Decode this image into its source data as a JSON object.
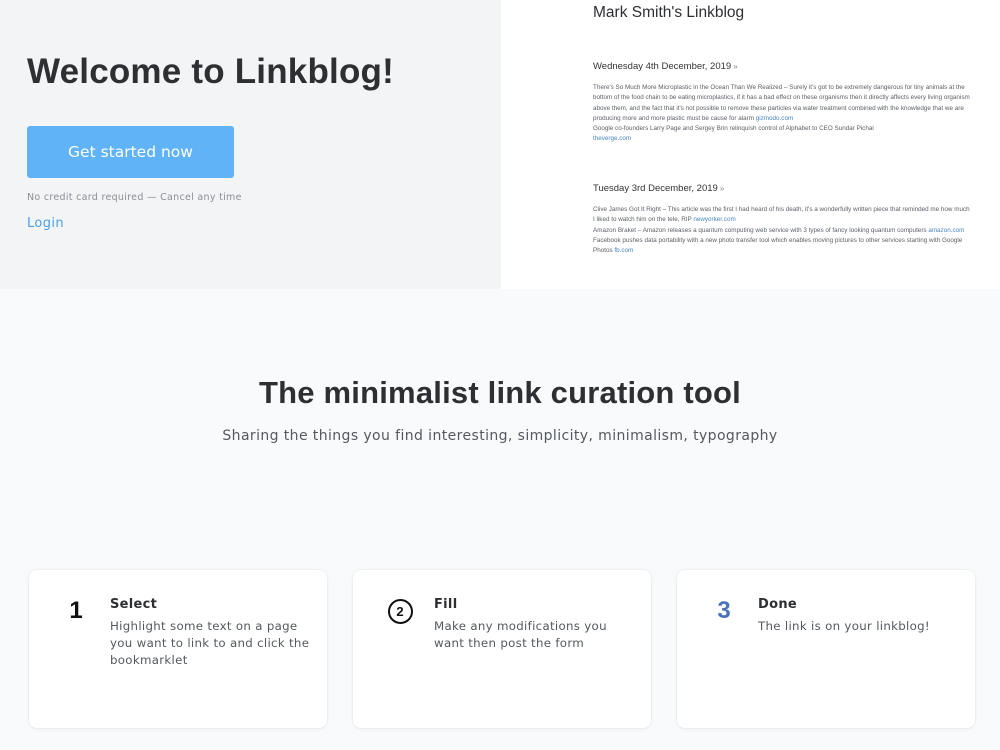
{
  "hero": {
    "title": "Welcome to Linkblog!",
    "cta_label": "Get started now",
    "fineprint": "No credit card required — Cancel any time",
    "login_label": "Login"
  },
  "preview": {
    "title": "Mark Smith's Linkblog",
    "days": [
      {
        "date": "Wednesday 4th December, 2019",
        "entries": [
          {
            "text": "There's So Much More Microplastic in the Ocean Than We Realized – Surely it's got to be extremely dangerous for tiny animals at the bottom of the food chain to be eating microplastics, if it has a bad effect on these organisms then it directly affects every living organism above them, and the fact that it's not possible to remove these particles via water treatment combined with the knowledge that we are producing more and more plastic must be cause for alarm",
            "domain": "gizmodo.com"
          },
          {
            "text": "Google co-founders Larry Page and Sergey Brin relinquish control of Alphabet to CEO Sundar Pichai",
            "domain": "theverge.com"
          }
        ]
      },
      {
        "date": "Tuesday 3rd December, 2019",
        "entries": [
          {
            "text": "Clive James Got It Right – This article was the first I had heard of his death, it's a wonderfully written piece that reminded me how much I liked to watch him on the tele, RIP",
            "domain": "newyorker.com"
          },
          {
            "text": "Amazon Braket – Amazon releases a quantum computing web service with 3 types of fancy looking quantum computers",
            "domain": "amazon.com"
          },
          {
            "text": "Facebook pushes data portability with a new photo transfer tool which enables moving pictures to other services starting with Google Photos",
            "domain": "fb.com"
          }
        ]
      }
    ]
  },
  "features": {
    "title": "The minimalist link curation tool",
    "subtitle": "Sharing the things you find interesting, simplicity, minimalism, typography",
    "steps": [
      {
        "number": "1",
        "title": "Select",
        "text": "Highlight some text on a page you want to link to and click the bookmarklet"
      },
      {
        "number": "2",
        "title": "Fill",
        "text": "Make any modifications you want then post the form"
      },
      {
        "number": "3",
        "title": "Done",
        "text": "The link is on your linkblog!"
      }
    ]
  },
  "colors": {
    "accent": "#5fb3f6",
    "link": "#4a9fe6",
    "step3_number": "#4a72b8"
  }
}
